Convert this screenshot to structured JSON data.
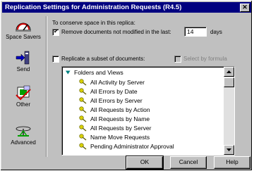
{
  "window": {
    "title": "Replication Settings for Administration Requests (R4.5)",
    "close_glyph": "✕"
  },
  "sidebar": {
    "items": [
      {
        "label": "Space Savers",
        "icon": "gauge-icon"
      },
      {
        "label": "Send",
        "icon": "send-arrow-icon"
      },
      {
        "label": "Other",
        "icon": "other-icon"
      },
      {
        "label": "Advanced",
        "icon": "advanced-icon"
      }
    ]
  },
  "space_savers": {
    "heading": "To conserve space in this replica:",
    "remove_docs": {
      "label": "Remove documents not modified in the last:",
      "checked": true
    },
    "days_value": "14",
    "days_unit": "days"
  },
  "subset": {
    "replicate_label": "Replicate a subset of documents:",
    "replicate_checked": false,
    "formula_label": "Select by formula",
    "formula_checked": false
  },
  "tree": {
    "root": "Folders and Views",
    "items": [
      "All Activity by Server",
      "All Errors by Date",
      "All Errors by Server",
      "All Requests by Action",
      "All Requests by Name",
      "All Requests by Server",
      "Name Move Requests",
      "Pending Administrator Approval"
    ]
  },
  "buttons": {
    "ok": "OK",
    "cancel": "Cancel",
    "help": "Help"
  },
  "colors": {
    "titlebar": "#000080",
    "face": "#c0c0c0",
    "tree_icon": "#c8c800"
  }
}
